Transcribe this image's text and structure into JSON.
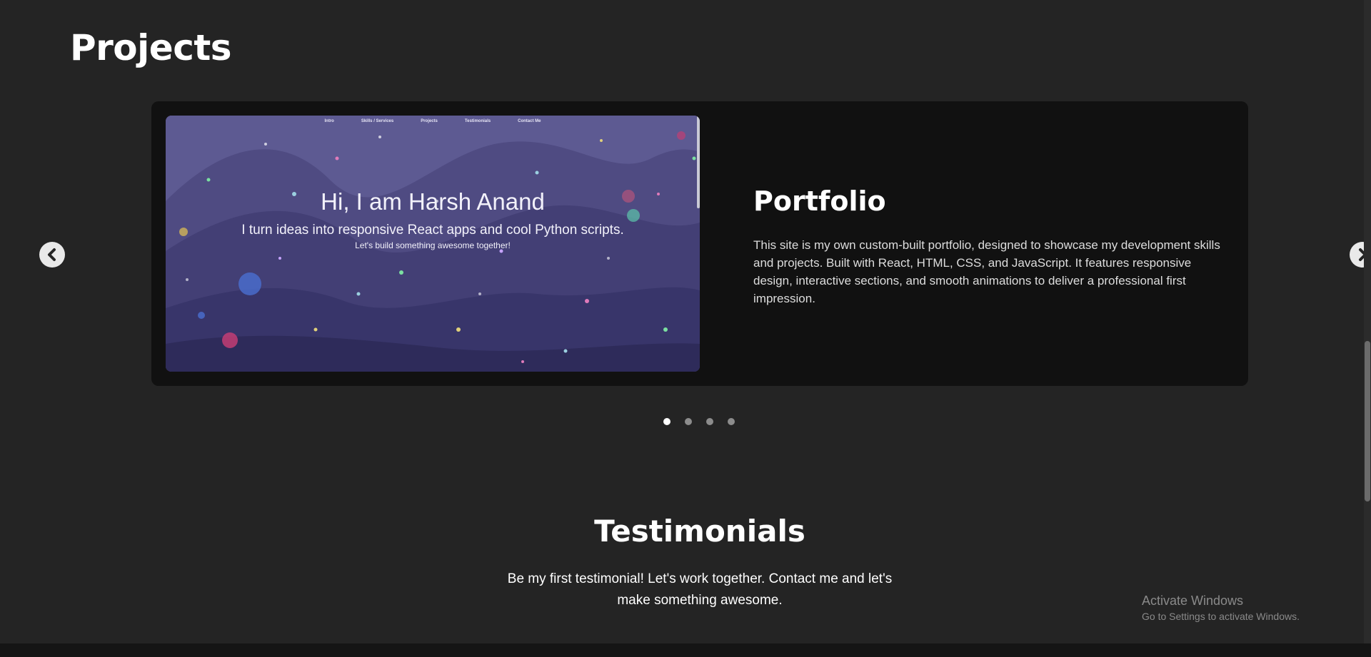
{
  "projects": {
    "title": "Projects",
    "slide": {
      "preview": {
        "nav": [
          "Intro",
          "Skills / Services",
          "Projects",
          "Testimonials",
          "Contact Me"
        ],
        "heading": "Hi, I am Harsh Anand",
        "subheading": "I turn ideas into responsive React apps and cool Python scripts.",
        "tagline": "Let's build something awesome together!"
      },
      "title": "Portfolio",
      "description": "This site is my own custom-built portfolio, designed to showcase my development skills and projects. Built with React, HTML, CSS, and JavaScript. It features responsive design, interactive sections, and smooth animations to deliver a professional first impression."
    },
    "dots": {
      "count": 4,
      "active_index": 0
    },
    "icons": {
      "prev": "chevron-left-icon",
      "next": "chevron-right-icon"
    }
  },
  "testimonials": {
    "title": "Testimonials",
    "text": "Be my first testimonial! Let's work together. Contact me and let's make something awesome."
  },
  "watermark": {
    "title": "Activate Windows",
    "subtitle": "Go to Settings to activate Windows."
  },
  "colors": {
    "page_background": "#242424",
    "card_background": "#111111",
    "preview_background": "#5d5a92",
    "dot_active": "#ffffff",
    "dot_inactive": "#8c8c8c"
  }
}
